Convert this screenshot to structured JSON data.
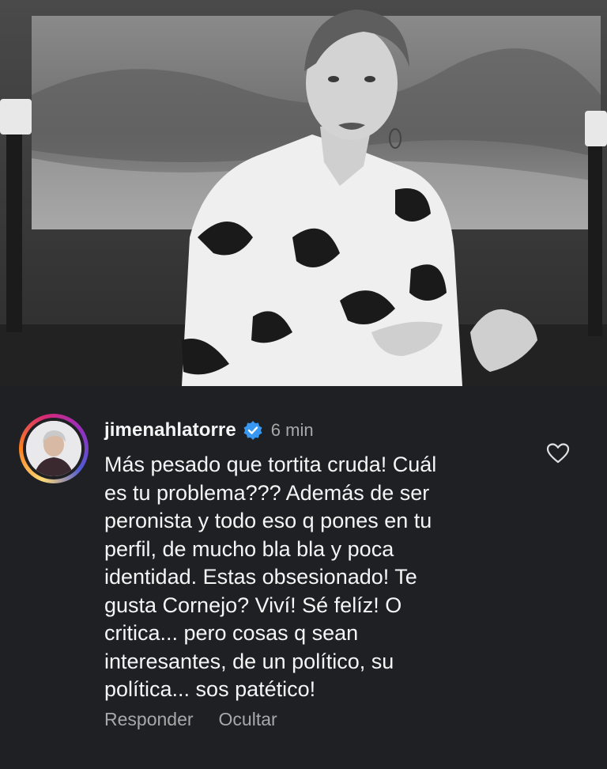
{
  "comment": {
    "username": "jimenahlatorre",
    "time": "6 min",
    "text": "Más pesado que tortita cruda! Cuál\nes tu problema??? Además de ser\nperonista y todo eso q pones en tu\nperfil, de mucho bla bla y poca\nidentidad. Estas obsesionado! Te\ngusta  Cornejo? Viví! Sé felíz! O\ncritica... pero cosas q sean\ninteresantes, de un político, su\npolítica... sos patético!",
    "reply_label": "Responder",
    "hide_label": "Ocultar"
  },
  "icons": {
    "verified": "verified-badge-icon",
    "like": "heart-icon"
  },
  "colors": {
    "background": "#1f2024",
    "text": "#f5f5f5",
    "muted": "#a8a8a8",
    "verified_blue": "#3897f0"
  }
}
